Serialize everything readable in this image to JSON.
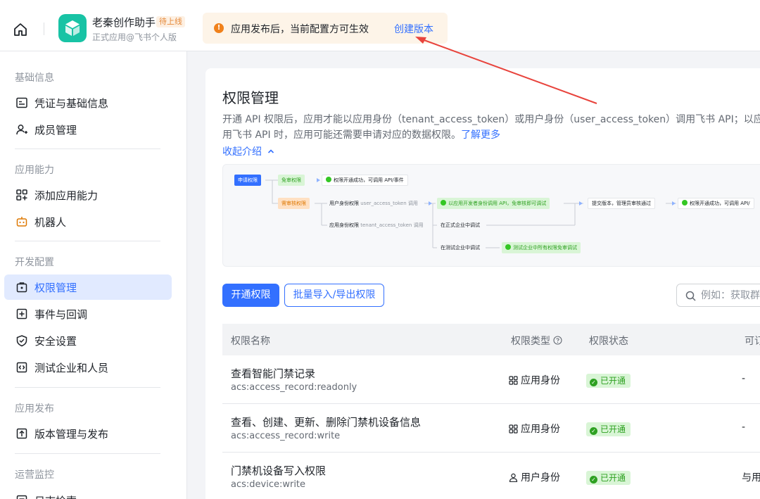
{
  "header": {
    "app_name": "老秦创作助手",
    "app_tag": "待上线",
    "app_subtitle": "正式应用@飞书个人版",
    "notice_text": "应用发布后，当前配置方可生效",
    "notice_link": "创建版本"
  },
  "sidebar": {
    "sections": [
      {
        "title": "基础信息",
        "items": [
          {
            "label": "凭证与基础信息",
            "icon": "credential-icon"
          },
          {
            "label": "成员管理",
            "icon": "member-icon"
          }
        ]
      },
      {
        "title": "应用能力",
        "items": [
          {
            "label": "添加应用能力",
            "icon": "add-capability-icon"
          },
          {
            "label": "机器人",
            "icon": "robot-icon"
          }
        ]
      },
      {
        "title": "开发配置",
        "items": [
          {
            "label": "权限管理",
            "icon": "permission-icon",
            "active": true
          },
          {
            "label": "事件与回调",
            "icon": "event-icon"
          },
          {
            "label": "安全设置",
            "icon": "security-icon"
          },
          {
            "label": "测试企业和人员",
            "icon": "test-icon"
          }
        ]
      },
      {
        "title": "应用发布",
        "items": [
          {
            "label": "版本管理与发布",
            "icon": "publish-icon"
          }
        ]
      },
      {
        "title": "运营监控",
        "items": [
          {
            "label": "日志检索",
            "icon": "log-icon"
          }
        ]
      }
    ]
  },
  "main": {
    "title": "权限管理",
    "desc_line1": "开通 API 权限后，应用才能以应用身份（tenant_access_token）或用户身份（user_access_token）调用飞书 API；以应用身",
    "desc_line2": "用飞书 API 时，应用可能还需要申请对应的数据权限。",
    "learn_more": "了解更多",
    "collapse": "收起介绍",
    "flow": {
      "apply": "申请权限",
      "no_review": "免审权限",
      "no_review_result": "权限开通成功，可调用 API/事件",
      "need_review": "需审核权限",
      "user_identity": "用户身份权限",
      "user_token": "user_access_token 调用",
      "dev_identity": "以应用开发者身份调用 API，免审核即可调试",
      "submit": "提交版本，管理员审核通过",
      "result2": "权限开通成功，可调用 API/",
      "app_identity": "应用身份权限",
      "tenant_token": "tenant_access_token 调用",
      "formal_debug": "在正式企业中调试",
      "test_debug": "在测试企业中调试",
      "test_result": "测试企业中所有权限免审调试"
    },
    "btn_open": "开通权限",
    "btn_batch": "批量导入/导出权限",
    "search_placeholder": "例如：获取群",
    "table": {
      "headers": {
        "name": "权限名称",
        "type": "权限类型",
        "status": "权限状态",
        "extra": "可订"
      },
      "rows": [
        {
          "name": "查看智能门禁记录",
          "code": "acs:access_record:readonly",
          "type": "应用身份",
          "type_icon": "app-identity-icon",
          "status": "已开通",
          "extra": "-"
        },
        {
          "name": "查看、创建、更新、删除门禁机设备信息",
          "code": "acs:access_record:write",
          "type": "应用身份",
          "type_icon": "app-identity-icon",
          "status": "已开通",
          "extra": "-"
        },
        {
          "name": "门禁机设备写入权限",
          "code": "acs:device:write",
          "type": "用户身份",
          "type_icon": "user-identity-icon",
          "status": "已开通",
          "extra": "与用"
        }
      ]
    }
  },
  "colors": {
    "accent": "#3370ff",
    "success": "#2ea121",
    "warning": "#f0811b",
    "annotation_arrow": "#e8433c"
  }
}
